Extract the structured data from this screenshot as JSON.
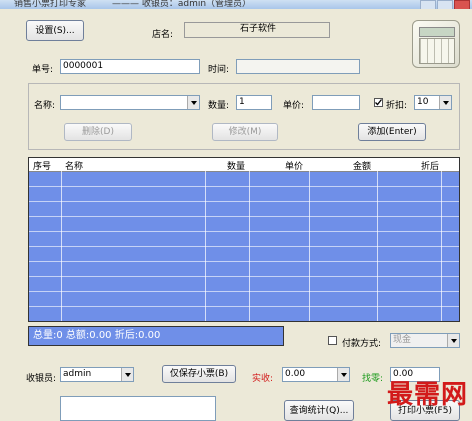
{
  "titlebar": {
    "title": "销售小票打印专家",
    "subtitle": "——— 收银员：admin（管理员）"
  },
  "top": {
    "settings_button": "设置(S)...",
    "shop_label": "店名:",
    "shop_value": "石子软件",
    "order_no_label": "单号:",
    "order_no_value": "0000001",
    "time_label": "时间:",
    "time_value": ""
  },
  "item_form": {
    "name_label": "名称:",
    "name_value": "",
    "qty_label": "数量:",
    "qty_value": "1",
    "price_label": "单价:",
    "price_value": "",
    "discount_label": "折扣:",
    "discount_value": "10",
    "delete_button": "删除(D)",
    "modify_button": "修改(M)",
    "add_button": "添加(Enter)"
  },
  "table": {
    "columns": [
      "序号",
      "名称",
      "数量",
      "单价",
      "金额",
      "折后"
    ],
    "rows": []
  },
  "summary": {
    "text": "总量:0  总额:0.00  折后:0.00"
  },
  "payment": {
    "label": "付款方式:",
    "method": "现金"
  },
  "bottom": {
    "cashier_label": "收银员:",
    "cashier_value": "admin",
    "save_only_button": "仅保存小票(B)",
    "received_label": "实收:",
    "received_value": "0.00",
    "change_label": "找零:",
    "change_value": "0.00",
    "query_button": "查询统计(Q)...",
    "print_button": "打印小票(F5)"
  },
  "watermark": "最需网",
  "colors": {
    "grid_blue": "#6f8fe8",
    "window_bg": "#ece9d8",
    "received_red": "#d21a1a",
    "change_green": "#1a9a1a"
  }
}
